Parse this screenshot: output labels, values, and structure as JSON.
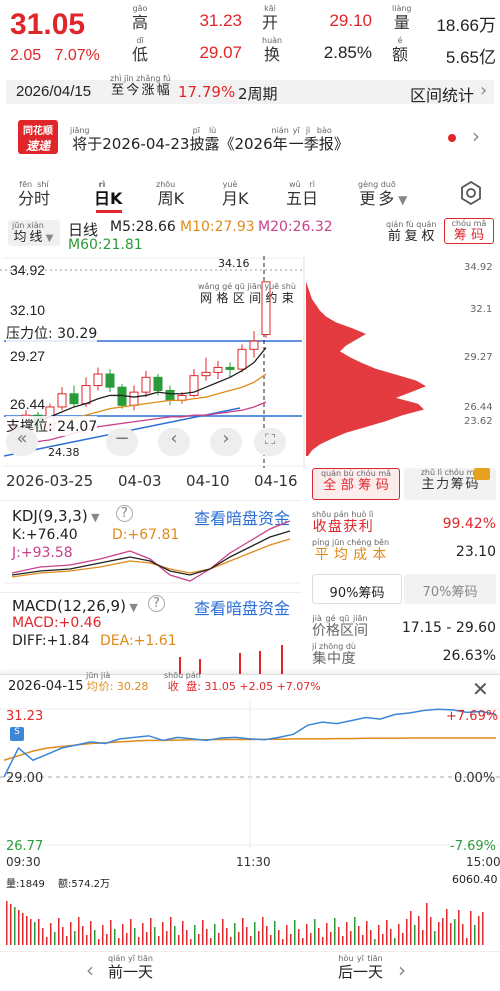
{
  "quote": {
    "price": "31.05",
    "change": "2.05",
    "change_pct": "7.07%",
    "high_label": "高",
    "high_ruby": "gāo",
    "high": "31.23",
    "open_label": "开",
    "open_ruby": "kāi",
    "open": "29.10",
    "volume_label": "量",
    "volume_ruby": "liàng",
    "volume": "18.66万",
    "low_label": "低",
    "low_ruby": "dī",
    "low": "29.07",
    "turnover_label": "换",
    "turnover_ruby": "huàn",
    "turnover": "2.85%",
    "amount_label": "额",
    "amount_ruby": "é",
    "amount": "5.65亿"
  },
  "datebar": {
    "date": "2026/04/15",
    "gain_label": "至今涨幅",
    "gain_ruby": "zhì jīn zhǎng fú",
    "gain_value": "17.79%",
    "period": "2周期",
    "range_stats": "区间统计"
  },
  "news": {
    "logo_top": "同花顺",
    "logo_bottom": "速递",
    "text": "将于2026-04-23披露《2026年一季报》",
    "ruby_jiang": "jiāng",
    "ruby_pilu": "pī lù",
    "ruby_nian": "nián",
    "ruby_yi": "yī",
    "ruby_jibao": "jì bào"
  },
  "tabs": [
    {
      "label": "分时",
      "ruby": "fēn shí"
    },
    {
      "label": "日K",
      "ruby": "rì"
    },
    {
      "label": "周K",
      "ruby": "zhōu"
    },
    {
      "label": "月K",
      "ruby": "yuè"
    },
    {
      "label": "五日",
      "ruby": "wǔ rì"
    },
    {
      "label": "更多",
      "ruby": "gèng duō"
    }
  ],
  "toolbar": {
    "ma_type": "均线",
    "ma_ruby": "jūn xiàn",
    "period": "日线",
    "m5": "M5:28.66",
    "m10": "M10:27.93",
    "m20": "M20:26.32",
    "m60": "M60:21.81",
    "adjust": "前复权",
    "adjust_ruby": "qián fù quán",
    "chips": "筹码",
    "chips_ruby": "chóu mǎ"
  },
  "kchart": {
    "y_left": [
      "34.92",
      "32.10",
      "29.27",
      "26.44"
    ],
    "y_right": [
      "34.92",
      "32.1",
      "29.27",
      "26.44",
      "23.62"
    ],
    "pressure": "压力位: 30.29",
    "support": "支撑位: 24.07",
    "max_label": "34.16",
    "min_label": "24.38",
    "grid_label": "网格区间约束",
    "grid_ruby": "wǎng gé qū jiān yuē shù"
  },
  "date_axis": [
    "2026-03-25",
    "04-03",
    "04-10",
    "04-16"
  ],
  "kdj": {
    "title": "KDJ(9,3,3)",
    "link": "查看暗盘资金",
    "k": "K:+76.40",
    "d": "D:+67.81",
    "j": "J:+93.58"
  },
  "macd": {
    "title": "MACD(12,26,9)",
    "link": "查看暗盘资金",
    "macd": "MACD:+0.46",
    "diff": "DIFF:+1.84",
    "dea": "DEA:+1.61"
  },
  "chips_panel": {
    "tab_all": "全部筹码",
    "tab_all_ruby": "quán bù chóu mǎ",
    "tab_main": "主力筹码",
    "tab_main_ruby": "zhǔ lì chóu mǎ",
    "profit_label": "收盘获利",
    "profit_ruby": "shōu pán huò lì",
    "profit": "99.42%",
    "cost_label": "平均成本",
    "cost_ruby": "píng jūn chéng běn",
    "cost": "23.10",
    "p90": "90%筹码",
    "p70": "70%筹码",
    "range_label": "价格区间",
    "range_ruby": "jià gé qū jiān",
    "range": "17.15 - 29.60",
    "conc_label": "集中度",
    "conc_ruby": "jí zhōng dù",
    "conc": "26.63%"
  },
  "minute": {
    "date": "2026-04-15",
    "avg_label": "均价",
    "avg_ruby": "jūn jià",
    "avg": "30.28",
    "close_label": "收盘",
    "close_ruby": "shōu pán",
    "close": "31.05 +2.05 +7.07%",
    "y_top": "31.23",
    "y_mid": "29.00",
    "y_bottom": "26.77",
    "pct_top": "+7.69%",
    "pct_mid": "0.00%",
    "pct_bottom": "-7.69%",
    "t_start": "09:30",
    "t_mid": "11:30",
    "t_end": "15:00",
    "vol_label": "量:1849",
    "amt_label": "额:574.2万",
    "vol_max": "6060.40",
    "prev_day": "前一天",
    "prev_ruby": "qián yī tiān",
    "next_day": "后一天",
    "next_ruby": "hòu yī tiān",
    "price_curve": [
      29.0,
      29.95,
      29.55,
      29.75,
      29.95,
      30.05,
      30.15,
      30.1,
      30.25,
      30.3,
      30.35,
      30.2,
      30.3,
      30.25,
      30.2,
      30.28,
      30.3,
      30.25,
      30.22,
      30.3,
      30.4,
      30.7,
      30.8,
      30.75,
      30.85,
      30.95,
      30.9,
      31.05,
      31.1,
      31.18,
      31.22,
      31.2,
      31.12,
      31.15,
      31.05
    ],
    "avg_curve": [
      29.55,
      29.7,
      29.85,
      29.95,
      30.0,
      30.05,
      30.1,
      30.12,
      30.15,
      30.18,
      30.2,
      30.2,
      30.21,
      30.22,
      30.22,
      30.23,
      30.23,
      30.23,
      30.24,
      30.24,
      30.25,
      30.25,
      30.25,
      30.26,
      30.26,
      30.27,
      30.27,
      30.27,
      30.28,
      30.28,
      30.28,
      30.28,
      30.28,
      30.28,
      30.28
    ]
  }
}
